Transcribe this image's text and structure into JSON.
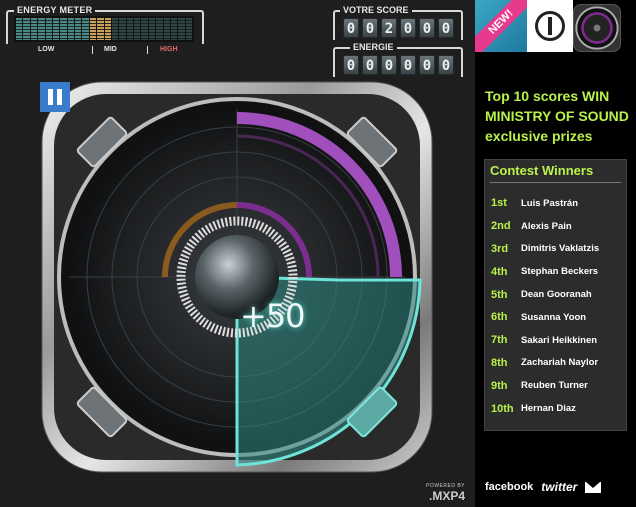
{
  "energy_meter": {
    "title": "ENERGY METER",
    "low": "LOW",
    "mid": "MID",
    "high": "HIGH"
  },
  "score": {
    "title": "VOTRE SCORE",
    "digits": [
      "0",
      "0",
      "2",
      "0",
      "0",
      "0"
    ]
  },
  "energy": {
    "title": "ENERGIE",
    "digits": [
      "0",
      "0",
      "0",
      "0",
      "0",
      "0"
    ]
  },
  "game": {
    "points_popup": "+50",
    "powered_by": "POWERED BY",
    "engine": ".MXP4"
  },
  "sidebar": {
    "badge": "NEW!",
    "promo": "Top 10 scores WIN MINISTRY OF SOUND exclusive prizes",
    "winners_title": "Contest Winners",
    "winners": [
      {
        "rank": "1st",
        "name": "Luis Pastrán"
      },
      {
        "rank": "2nd",
        "name": "Alexis Pain"
      },
      {
        "rank": "3rd",
        "name": "Dimitris Vaklatzis"
      },
      {
        "rank": "4th",
        "name": "Stephan Beckers"
      },
      {
        "rank": "5th",
        "name": "Dean  Gooranah"
      },
      {
        "rank": "6th",
        "name": "Susanna  Yoon"
      },
      {
        "rank": "7th",
        "name": "Sakari Heikkinen"
      },
      {
        "rank": "8th",
        "name": "Zachariah Naylor"
      },
      {
        "rank": "9th",
        "name": "Reuben Turner"
      },
      {
        "rank": "10th",
        "name": "Hernan Diaz"
      }
    ],
    "facebook": "facebook",
    "twitter": "twitter"
  },
  "colors": {
    "accent_green": "#b8f24a",
    "ring_purple": "#9b3fb5",
    "teal_active": "#5fd3c7",
    "pause_blue": "#3a7ccc"
  }
}
